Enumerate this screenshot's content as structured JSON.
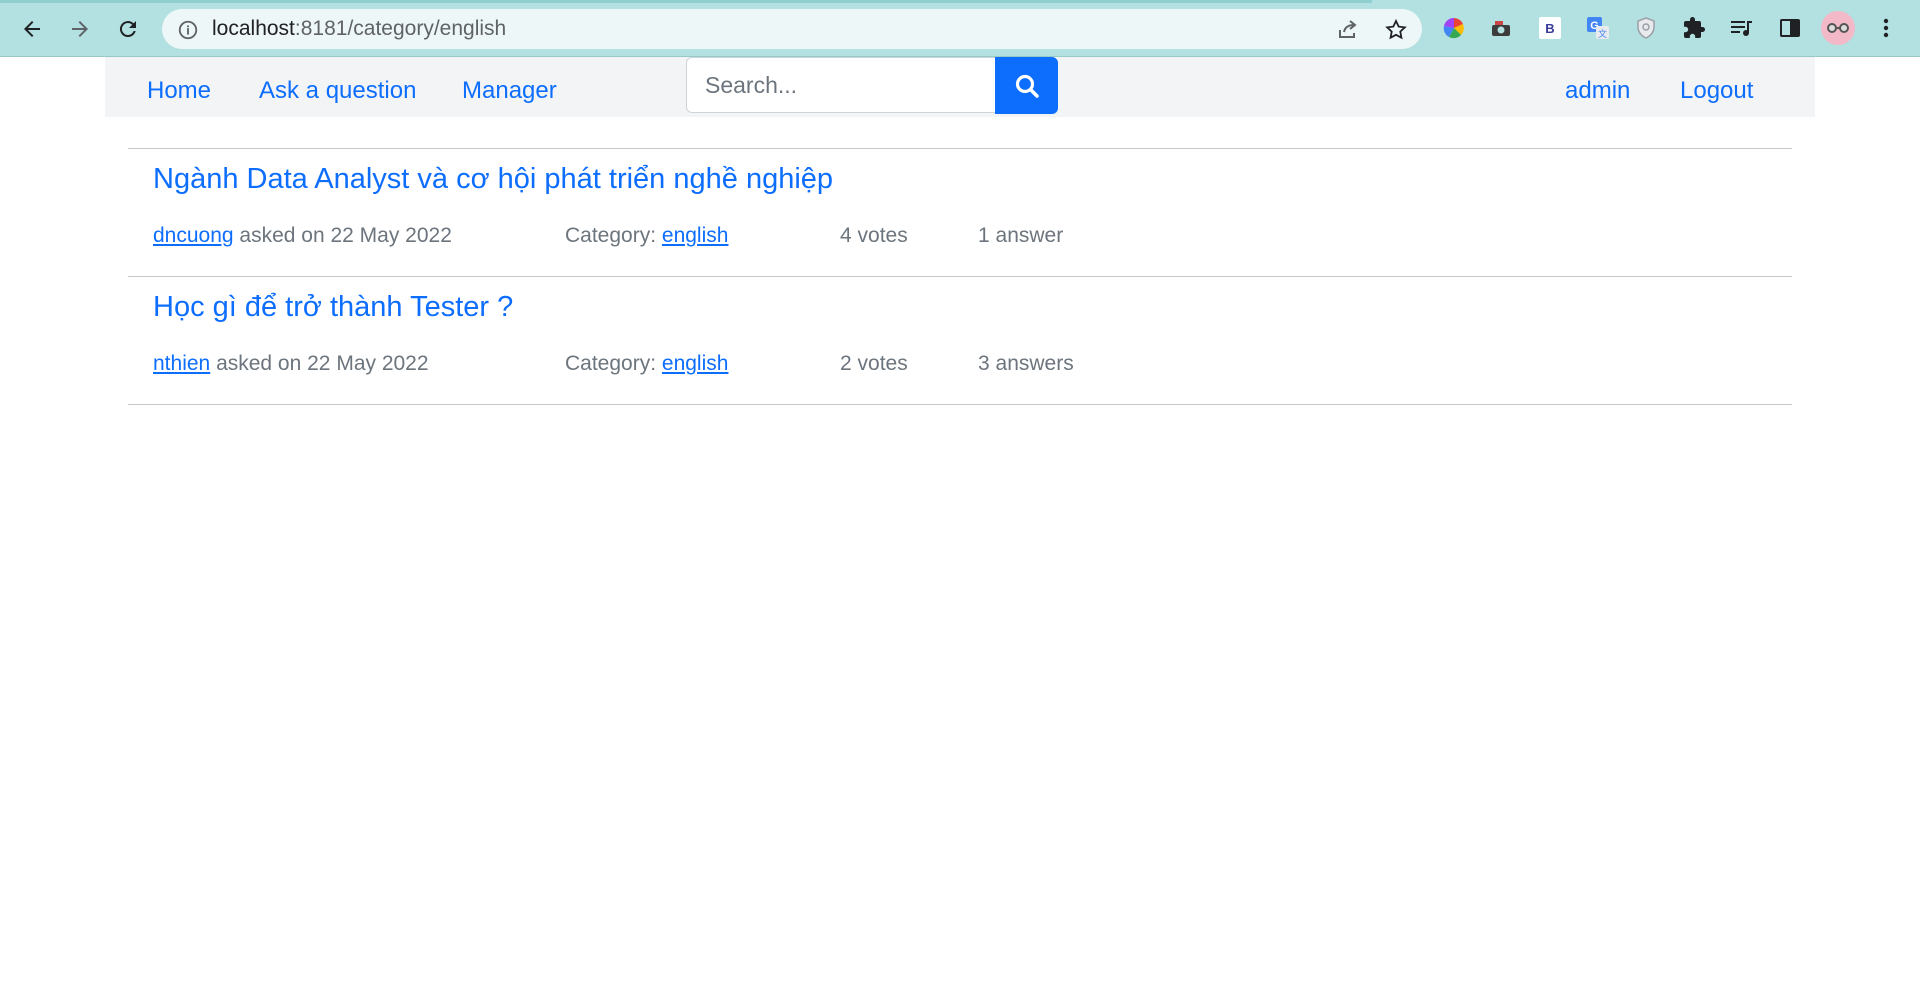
{
  "browser": {
    "url_host": "localhost",
    "url_path": ":8181/category/english",
    "extensions": [
      "color-wheel-icon",
      "camera-extension-icon",
      "bootstrap-b-icon",
      "google-translate-icon",
      "shield-extension-icon",
      "puzzle-icon",
      "media-list-icon",
      "sidebar-icon",
      "profile-avatar-icon",
      "more-vert-icon"
    ]
  },
  "navbar": {
    "home": "Home",
    "ask": "Ask a question",
    "manager": "Manager",
    "search_placeholder": "Search...",
    "user": "admin",
    "logout": "Logout"
  },
  "questions": [
    {
      "title": "Ngành Data Analyst và cơ hội phát triển nghề nghiệp",
      "author": "dncuong",
      "asked": "asked on 22 May 2022",
      "category_label": "Category:",
      "category": "english",
      "votes": "4 votes",
      "answers": "1 answer"
    },
    {
      "title": "Học gì để trở thành Tester ?",
      "author": "nthien",
      "asked": "asked on 22 May 2022",
      "category_label": "Category:",
      "category": "english",
      "votes": "2 votes",
      "answers": "3 answers"
    }
  ],
  "colors": {
    "accent": "#0d6efd",
    "chrome": "#b3e0e0",
    "navbar_bg": "#f3f4f6",
    "muted_text": "#6c757d"
  }
}
